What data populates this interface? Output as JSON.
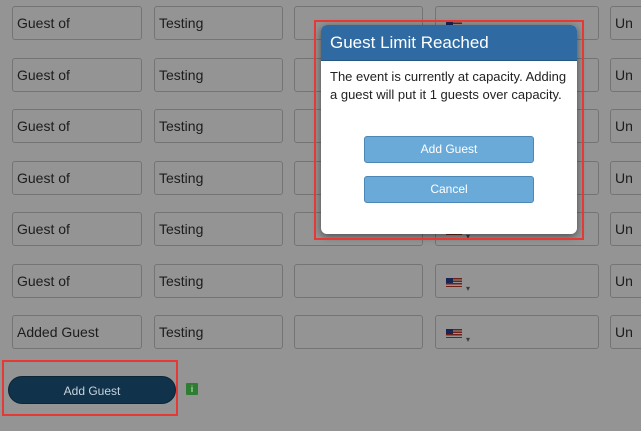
{
  "guest_rows": [
    {
      "name": "Guest of",
      "last": "Testing",
      "extra": "",
      "phone_country": "us-flag",
      "status": "Un"
    },
    {
      "name": "Guest of",
      "last": "Testing",
      "extra": "",
      "phone_country": "us-flag",
      "status": "Un"
    },
    {
      "name": "Guest of",
      "last": "Testing",
      "extra": "",
      "phone_country": "us-flag",
      "status": "Un"
    },
    {
      "name": "Guest of",
      "last": "Testing",
      "extra": "",
      "phone_country": "us-flag",
      "status": "Un"
    },
    {
      "name": "Guest of",
      "last": "Testing",
      "extra": "",
      "phone_country": "us-flag",
      "status": "Un"
    },
    {
      "name": "Guest of",
      "last": "Testing",
      "extra": "",
      "phone_country": "us-flag",
      "status": "Un"
    },
    {
      "name": "Added Guest",
      "last": "Testing",
      "extra": "",
      "phone_country": "us-flag",
      "status": "Un"
    }
  ],
  "dropdown_caret": "▾",
  "add_guest_button": "Add Guest",
  "info_icon": "i",
  "modal": {
    "title": "Guest Limit Reached",
    "message": "The event is currently at capacity. Adding a guest will put it 1 guests over capacity.",
    "add_guest_label": "Add Guest",
    "cancel_label": "Cancel"
  },
  "colors": {
    "modal_header": "#2f6aa3",
    "modal_button": "#6aaad8",
    "main_button": "#10324a",
    "highlight": "#e53935"
  }
}
